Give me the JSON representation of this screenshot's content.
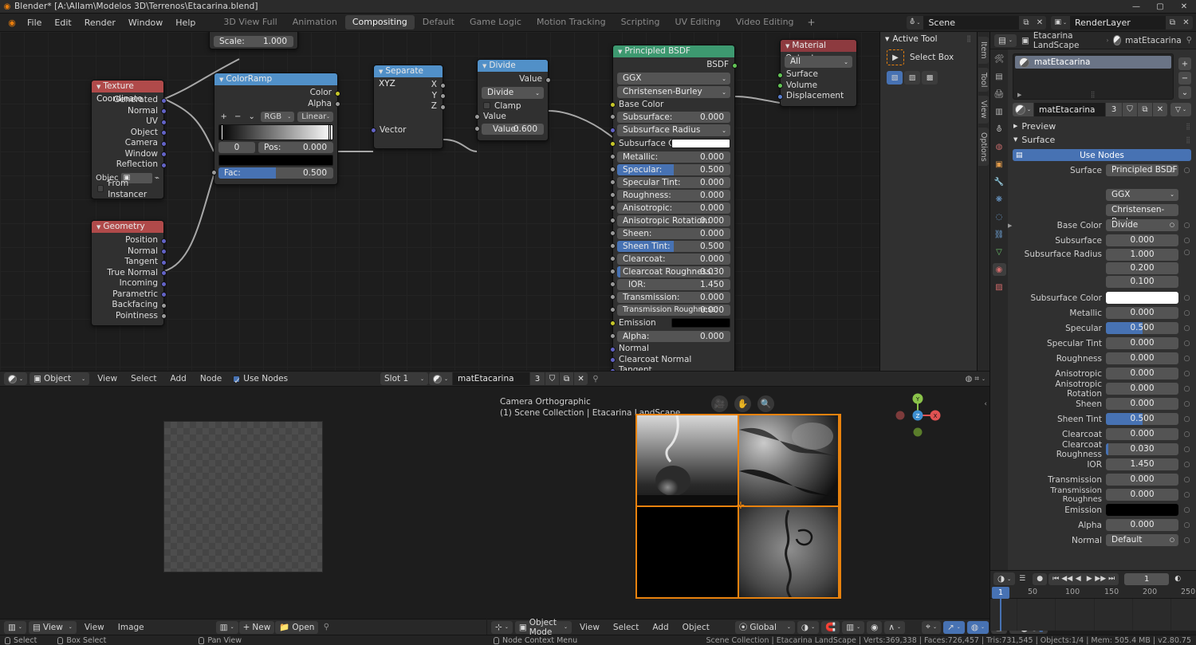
{
  "window": {
    "title": "Blender* [A:\\Allam\\Modelos 3D\\Terrenos\\Etacarina.blend]",
    "minimize": "—",
    "maximize": "▢",
    "close": "✕"
  },
  "topbar": {
    "menus": [
      "File",
      "Edit",
      "Render",
      "Window",
      "Help"
    ],
    "workspaces": [
      {
        "label": "3D View Full",
        "active": false
      },
      {
        "label": "Animation",
        "active": false
      },
      {
        "label": "Compositing",
        "active": true
      },
      {
        "label": "Default",
        "active": false
      },
      {
        "label": "Game Logic",
        "active": false
      },
      {
        "label": "Motion Tracking",
        "active": false
      },
      {
        "label": "Scripting",
        "active": false
      },
      {
        "label": "UV Editing",
        "active": false
      },
      {
        "label": "Video Editing",
        "active": false
      }
    ],
    "add_workspace": "+",
    "scene": {
      "name": "Scene",
      "copy": "⧉",
      "unlink": "✕"
    },
    "viewlayer": {
      "name": "RenderLayer",
      "copy": "⧉",
      "unlink": "✕"
    }
  },
  "node_editor": {
    "floating_label": "matEtacarina",
    "scale_field": {
      "label": "Scale:",
      "value": "1.000"
    },
    "nodes": {
      "texture_coordinate": {
        "title": "Texture Coordinate",
        "outputs": [
          "Generated",
          "Normal",
          "UV",
          "Object",
          "Camera",
          "Window",
          "Reflection"
        ],
        "object_label": "Objec",
        "from_instancer": "From Instancer"
      },
      "geometry": {
        "title": "Geometry",
        "outputs": [
          "Position",
          "Normal",
          "Tangent",
          "True Normal",
          "Incoming",
          "Parametric",
          "Backfacing",
          "Pointiness"
        ]
      },
      "colorramp": {
        "title": "ColorRamp",
        "outputs": [
          "Color",
          "Alpha"
        ],
        "add": "+",
        "remove": "−",
        "menu": "⌄",
        "interp_color": "RGB",
        "interp_mode": "Linear",
        "index": "0",
        "pos_label": "Pos:",
        "pos_value": "0.000",
        "fac_label": "Fac:",
        "fac_value": "0.500"
      },
      "separate_xyz": {
        "title": "Separate XYZ",
        "outputs": [
          "X",
          "Y",
          "Z"
        ],
        "inputs": [
          "Vector"
        ]
      },
      "divide": {
        "title": "Divide",
        "output": "Value",
        "operation": "Divide",
        "clamp": "Clamp",
        "input_value_label": "Value",
        "value_label": "Value:",
        "value": "0.600"
      },
      "principled_bsdf": {
        "title": "Principled BSDF",
        "output": "BSDF",
        "distribution": "GGX",
        "subsurface_method": "Christensen-Burley",
        "inputs": [
          {
            "label": "Base Color",
            "type": "color_link",
            "sock": "s-yellow"
          },
          {
            "label": "Subsurface:",
            "value": "0.000",
            "type": "value",
            "sock": "s-grey"
          },
          {
            "label": "Subsurface Radius",
            "type": "dropdown",
            "sock": "s-purple"
          },
          {
            "label": "Subsurface Color",
            "type": "swatch",
            "color": "#ffffff",
            "sock": "s-yellow"
          },
          {
            "label": "Metallic:",
            "value": "0.000",
            "type": "value",
            "sock": "s-grey"
          },
          {
            "label": "Specular:",
            "value": "0.500",
            "type": "value",
            "fill": 50,
            "sock": "s-grey"
          },
          {
            "label": "Specular Tint:",
            "value": "0.000",
            "type": "value",
            "sock": "s-grey"
          },
          {
            "label": "Roughness:",
            "value": "0.000",
            "type": "value",
            "sock": "s-grey"
          },
          {
            "label": "Anisotropic:",
            "value": "0.000",
            "type": "value",
            "sock": "s-grey"
          },
          {
            "label": "Anisotropic Rotation:",
            "value": "0.000",
            "type": "value",
            "sock": "s-grey"
          },
          {
            "label": "Sheen:",
            "value": "0.000",
            "type": "value",
            "sock": "s-grey"
          },
          {
            "label": "Sheen Tint:",
            "value": "0.500",
            "type": "value",
            "fill": 50,
            "sock": "s-grey"
          },
          {
            "label": "Clearcoat:",
            "value": "0.000",
            "type": "value",
            "sock": "s-grey"
          },
          {
            "label": "Clearcoat Roughness:",
            "value": "0.030",
            "type": "value",
            "fill": 3,
            "sock": "s-grey"
          },
          {
            "label": "IOR:",
            "value": "1.450",
            "type": "value",
            "sock": "s-grey"
          },
          {
            "label": "Transmission:",
            "value": "0.000",
            "type": "value",
            "sock": "s-grey"
          },
          {
            "label": "Transmission Roughness:",
            "value": "0.000",
            "type": "value",
            "sock": "s-grey"
          },
          {
            "label": "Emission",
            "type": "swatch",
            "color": "#000000",
            "sock": "s-yellow"
          },
          {
            "label": "Alpha:",
            "value": "0.000",
            "type": "value",
            "sock": "s-grey"
          },
          {
            "label": "Normal",
            "type": "plain",
            "sock": "s-purple"
          },
          {
            "label": "Clearcoat Normal",
            "type": "plain",
            "sock": "s-purple"
          },
          {
            "label": "Tangent",
            "type": "plain",
            "sock": "s-purple"
          }
        ]
      },
      "material_output": {
        "title": "Material Output",
        "target": "All",
        "inputs": [
          "Surface",
          "Volume",
          "Displacement"
        ]
      }
    },
    "header": {
      "editor_type": "node-editor-icon",
      "shader_type": "Object",
      "menus": [
        "View",
        "Select",
        "Add",
        "Node"
      ],
      "use_nodes": "Use Nodes",
      "slot": "Slot 1",
      "material_name": "matEtacarina",
      "users": "3",
      "shield": "⛉",
      "copy": "⧉",
      "unlink": "✕",
      "pin": "⚲",
      "right_icons": [
        "overlay-icon",
        "snap-icon",
        "proportional-icon"
      ]
    }
  },
  "active_tool_panel": {
    "title": "Active Tool",
    "tool_name": "Select Box",
    "modes": [
      "set-mode",
      "extend-mode",
      "subtract-mode"
    ],
    "tabs": [
      "Item",
      "Tool",
      "View",
      "Options"
    ]
  },
  "properties": {
    "breadcrumb": [
      {
        "label": "Etacarina LandScape",
        "icon": "object-icon"
      },
      {
        "label": "matEtacarina",
        "icon": "material-icon"
      }
    ],
    "tab_icons": [
      "tool-icon",
      "render-icon",
      "output-icon",
      "viewlayer-icon",
      "scene-icon",
      "world-icon",
      "object-icon",
      "modifier-icon",
      "particles-icon",
      "physics-icon",
      "constraint-icon",
      "data-icon",
      "material-icon",
      "texture-icon"
    ],
    "material_slots": [
      {
        "name": "matEtacarina",
        "selected": true
      }
    ],
    "slot_buttons": {
      "add": "+",
      "remove": "−",
      "menu": "⌄"
    },
    "id_row": {
      "name": "matEtacarina",
      "users": "3",
      "shield": "⛉",
      "copy": "⧉",
      "unlink": "✕",
      "nodetree": "nodetree-icon"
    },
    "panels": [
      {
        "label": "Preview",
        "open": false
      },
      {
        "label": "Surface",
        "open": true
      }
    ],
    "use_nodes": "Use Nodes",
    "surface_rows": [
      {
        "label": "Surface",
        "value": "Principled BSDF",
        "kind": "dd"
      },
      {
        "label": "",
        "value": "GGX",
        "kind": "dd"
      },
      {
        "label": "",
        "value": "Christensen-Burley",
        "kind": "dd"
      },
      {
        "label": "Base Color",
        "value": "Divide",
        "kind": "dd",
        "expand": true
      },
      {
        "label": "Subsurface",
        "value": "0.000",
        "kind": "num"
      },
      {
        "label": "Subsurface Radius",
        "value": "1.000",
        "kind": "vec",
        "extra": [
          "0.200",
          "0.100"
        ]
      },
      {
        "label": "Subsurface Color",
        "value": "",
        "kind": "color",
        "color": "#ffffff"
      },
      {
        "label": "Metallic",
        "value": "0.000",
        "kind": "num"
      },
      {
        "label": "Specular",
        "value": "0.500",
        "kind": "num",
        "fill": 50
      },
      {
        "label": "Specular Tint",
        "value": "0.000",
        "kind": "num"
      },
      {
        "label": "Roughness",
        "value": "0.000",
        "kind": "num"
      },
      {
        "label": "Anisotropic",
        "value": "0.000",
        "kind": "num"
      },
      {
        "label": "Anisotropic Rotation",
        "value": "0.000",
        "kind": "num"
      },
      {
        "label": "Sheen",
        "value": "0.000",
        "kind": "num"
      },
      {
        "label": "Sheen Tint",
        "value": "0.500",
        "kind": "num",
        "fill": 50
      },
      {
        "label": "Clearcoat",
        "value": "0.000",
        "kind": "num"
      },
      {
        "label": "Clearcoat Roughness",
        "value": "0.030",
        "kind": "num",
        "fill": 3
      },
      {
        "label": "IOR",
        "value": "1.450",
        "kind": "num"
      },
      {
        "label": "Transmission",
        "value": "0.000",
        "kind": "num"
      },
      {
        "label": "Transmission Roughnes",
        "value": "0.000",
        "kind": "num"
      },
      {
        "label": "Emission",
        "value": "",
        "kind": "color",
        "color": "#000000"
      },
      {
        "label": "Alpha",
        "value": "0.000",
        "kind": "num"
      },
      {
        "label": "Normal",
        "value": "Default",
        "kind": "dd"
      }
    ]
  },
  "image_editor": {
    "header": {
      "editor_icon": "image-editor-icon",
      "mode": "View",
      "menus": [
        "View",
        "Image"
      ],
      "browse": "browse-image-icon",
      "new": "New",
      "open": "Open",
      "pin": "⚲"
    }
  },
  "viewport": {
    "view_name": "Camera Orthographic",
    "collection_line": "(1) Scene Collection | Etacarina LandScape",
    "gizmo_buttons": [
      "camera-icon",
      "hand-icon",
      "zoom-icon"
    ],
    "axes": {
      "x": "X",
      "y": "Y",
      "z": "Z"
    },
    "header": {
      "editor_icon": "view3d-icon",
      "mode": "Object Mode",
      "menus": [
        "View",
        "Select",
        "Add",
        "Object"
      ],
      "transform_orientation": "Global",
      "pivot": "pivot-icon",
      "snap": "magnet-icon",
      "proportional": "proportional-icon",
      "shading_modes": [
        "wireframe",
        "solid",
        "lookdev",
        "rendered"
      ]
    }
  },
  "timeline": {
    "editor_icon": "timeline-icon",
    "menu_icon": "☰",
    "record": "●",
    "jump_start": "⏮",
    "prev_key": "◀◀",
    "play_rev": "◀",
    "play": "▶",
    "next_key": "▶▶",
    "jump_end": "⏭",
    "current_frame": "1",
    "ticks": [
      "50",
      "100",
      "150",
      "200",
      "250"
    ],
    "playhead_label": "1"
  },
  "statusbar": {
    "hints": [
      {
        "icon": "mouse-left",
        "label": "Select"
      },
      {
        "icon": "mouse-left-drag",
        "label": "Box Select"
      },
      {
        "icon": "mouse-middle",
        "label": "Pan View"
      },
      {
        "icon": "mouse-right",
        "label": "Node Context Menu"
      }
    ],
    "stats": "Scene Collection | Etacarina LandScape | Verts:369,338 | Faces:726,457 | Tris:731,545 | Objects:1/4 | Mem: 505.4 MB | v2.80.75"
  },
  "colors": {
    "accent": "#4772b3",
    "orange": "#e8820e",
    "node_red": "#b04a4a",
    "node_green": "#3d9970",
    "node_blue": "#5190c8",
    "node_output": "#8d3a3f"
  }
}
